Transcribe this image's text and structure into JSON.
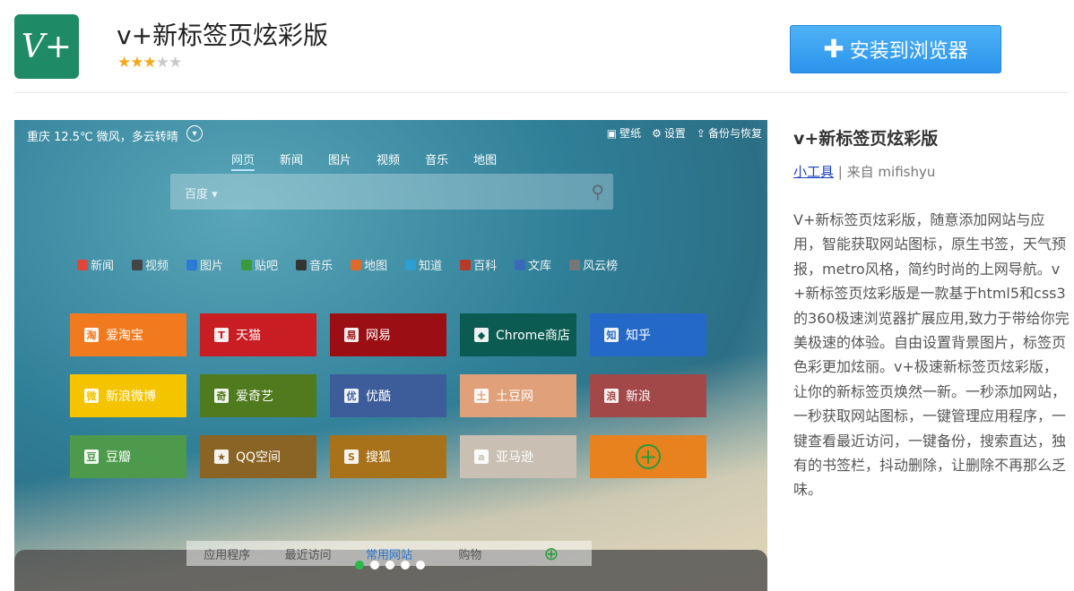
{
  "app": {
    "icon_text": "V+",
    "title": "v+新标签页炫彩版",
    "rating_stars_filled": 3,
    "rating_stars_total": 5,
    "install_label": "安装到浏览器",
    "install_icon": "plus-icon"
  },
  "screenshot": {
    "weather": "重庆 12.5℃ 微风，多云转晴",
    "top_actions": [
      {
        "icon": "wallpaper-icon",
        "label": "壁纸"
      },
      {
        "icon": "gear-icon",
        "label": "设置"
      },
      {
        "icon": "backup-icon",
        "label": "备份与恢复"
      }
    ],
    "search_tabs": [
      "网页",
      "新闻",
      "图片",
      "视频",
      "音乐",
      "地图"
    ],
    "search_active_tab": "网页",
    "search_engine": "百度 ▾",
    "quick_links": [
      "新闻",
      "视频",
      "图片",
      "贴吧",
      "音乐",
      "地图",
      "知道",
      "百科",
      "文库",
      "风云榜"
    ],
    "tiles": [
      {
        "label": "爱淘宝",
        "color": "#f07a1d",
        "icon": "淘"
      },
      {
        "label": "天猫",
        "color": "#c81d22",
        "icon": "T"
      },
      {
        "label": "网易",
        "color": "#9b0f14",
        "icon": "易"
      },
      {
        "label": "Chrome商店",
        "color": "#0c5b52",
        "icon": "◆"
      },
      {
        "label": "知乎",
        "color": "#2569c8",
        "icon": "知"
      },
      {
        "label": "新浪微博",
        "color": "#f5c400",
        "icon": "微"
      },
      {
        "label": "爱奇艺",
        "color": "#4f7a1d",
        "icon": "奇"
      },
      {
        "label": "优酷",
        "color": "#3c5d9a",
        "icon": "优"
      },
      {
        "label": "土豆网",
        "color": "#e0a07a",
        "icon": "土"
      },
      {
        "label": "新浪",
        "color": "#a34848",
        "icon": "浪"
      },
      {
        "label": "豆瓣",
        "color": "#4e9a4c",
        "icon": "豆"
      },
      {
        "label": "QQ空间",
        "color": "#8a6424",
        "icon": "★"
      },
      {
        "label": "搜狐",
        "color": "#a8721a",
        "icon": "S"
      },
      {
        "label": "亚马逊",
        "color": "#c9c0b3",
        "icon": "a"
      }
    ],
    "add_tile_color": "#e8821e",
    "bottom_tabs": [
      "应用程序",
      "最近访问",
      "常用网站",
      "购物"
    ],
    "bottom_active_tab": "常用网站",
    "page_dots": 5,
    "page_dot_active": 1
  },
  "info": {
    "title": "v+新标签页炫彩版",
    "category": "小工具",
    "separator": "|",
    "source": "来自 mifishyu",
    "description": "V+新标签页炫彩版，随意添加网站与应用，智能获取网站图标，原生书签，天气预报，metro风格，简约时尚的上网导航。v+新标签页炫彩版是一款基于html5和css3的360极速浏览器扩展应用,致力于带给你完美极速的体验。自由设置背景图片，标签页色彩更加炫丽。v+极速新标签页炫彩版，让你的新标签页焕然一新。一秒添加网站，一秒获取网站图标，一键管理应用程序，一键查看最近访问，一键备份，搜索直达，独有的书签栏，抖动删除，让删除不再那么乏味。"
  }
}
